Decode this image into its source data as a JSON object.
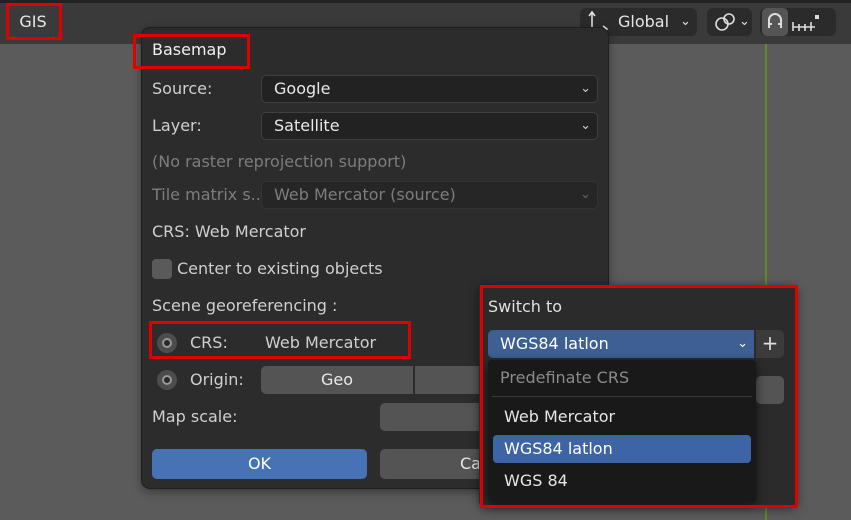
{
  "topbar": {
    "menu_gis": "GIS",
    "orientation_label": "Global",
    "orientation_icon": "transform-orientation-icon",
    "pivot_icon": "pivot-link-icon",
    "snap_icon": "snap-magnet-icon",
    "snap_increment_icon": "snap-increment-icon"
  },
  "panel": {
    "title": "Basemap",
    "source_label": "Source:",
    "source_value": "Google",
    "layer_label": "Layer:",
    "layer_value": "Satellite",
    "reprojection_note": "(No raster reprojection support)",
    "tile_matrix_label": "Tile matrix s...",
    "tile_matrix_value": "Web Mercator (source)",
    "crs_info": "CRS: Web Mercator",
    "center_checkbox_label": "Center to existing objects",
    "scene_geo_label": "Scene georeferencing :",
    "crs_label": "CRS:",
    "crs_value": "Web Mercator",
    "origin_label": "Origin:",
    "origin_geo": "Geo",
    "map_scale_label": "Map scale:",
    "ok_button": "OK",
    "cancel_button": "Car"
  },
  "popup": {
    "title": "Switch to",
    "selected_value": "WGS84 latlon",
    "plus_button": "+",
    "menu_header": "Predefinate CRS",
    "menu_items": [
      "Web Mercator",
      "WGS84 latlon",
      "WGS 84"
    ],
    "active_index": 1
  },
  "colors": {
    "highlight": "#e10000",
    "accent_blue": "#4772b3",
    "menu_active": "#3d64a5",
    "panel_bg": "#2c2c2c"
  }
}
